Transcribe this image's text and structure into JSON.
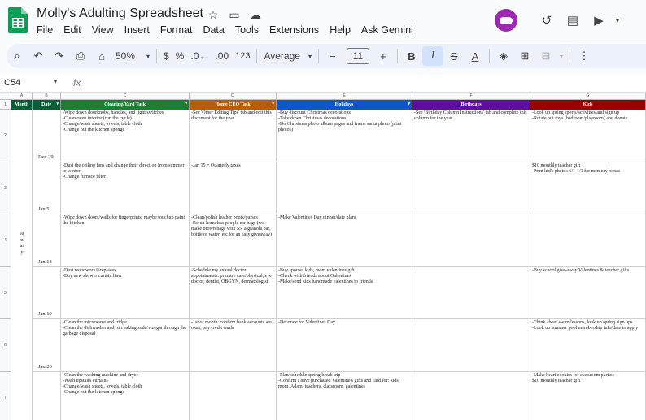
{
  "app": {
    "title": "Molly's Adulting Spreadsheet",
    "menu": [
      "File",
      "Edit",
      "View",
      "Insert",
      "Format",
      "Data",
      "Tools",
      "Extensions",
      "Help",
      "Ask Gemini"
    ]
  },
  "toolbar": {
    "zoom": "50%",
    "currency": "$",
    "percent": "%",
    "dec_decrease": ".0←",
    "dec_increase": ".00",
    "number_format": "123",
    "font": "Average",
    "font_size": "11",
    "bold": "B",
    "italic": "I",
    "strike": "S",
    "text_color": "A"
  },
  "formula_bar": {
    "cell_ref": "C54",
    "fx": "fx"
  },
  "columns": {
    "letters": [
      "A",
      "B",
      "C",
      "D",
      "E",
      "F",
      "G"
    ],
    "headers": [
      {
        "label": "Month",
        "color": "#0b5d3a"
      },
      {
        "label": "Date",
        "color": "#0b5d3a"
      },
      {
        "label": "Cleaning/Yard Task",
        "color": "#1e7e34"
      },
      {
        "label": "Home CEO Task",
        "color": "#b45f06"
      },
      {
        "label": "Holidays",
        "color": "#1155cc"
      },
      {
        "label": "Birthdays",
        "color": "#5b0f9b"
      },
      {
        "label": "Kids",
        "color": "#990000"
      }
    ]
  },
  "month_label": "January",
  "rows": [
    {
      "num": "2",
      "date": "Dec 29",
      "cleaning": "-Wipe down doorknobs, handles, and light switches\n-Clean oven interior (run the cycle)\n-Change/wash sheets, towels, table cloth\n-Change out the kitchen sponge",
      "ceo": "-See 'Other Editing Tips' tab and edit this document for the year",
      "holidays": "-Buy discount Christmas decorations\n-Take down Christmas decorations\n-Do Christmas photo album pages and frame santa photo (print photos)",
      "birthdays": "-See 'Birthday Column Instructions' tab and complete this column for the year",
      "kids": "-Look up spring sports/activities and sign up\n-Rotate out toys (bedroom/playroom) and donate"
    },
    {
      "num": "3",
      "date": "Jan 5",
      "cleaning": "-Dust the ceiling fans and change their direction from summer to winter\n-Change furnace filter",
      "ceo": "-Jan 15 = Quarterly taxes",
      "holidays": "",
      "birthdays": "",
      "kids": "$10 monthly teacher gift\n-Print kid's photos 6/1-1/1 for memory boxes"
    },
    {
      "num": "4",
      "date": "Jan 12",
      "cleaning": "-Wipe down doors/walls for fingerprints, maybe touchup paint the kitchen",
      "ceo": "-Clean/polish leather boots/purses\n-Re-up homeless people car bags (we make brown bags with $5, a granola bar, bottle of water, etc for an easy giveaway)",
      "holidays": "-Make Valentines Day dinner/date plans",
      "birthdays": "",
      "kids": ""
    },
    {
      "num": "5",
      "date": "Jan 19",
      "cleaning": "-Dust woodwork/fireplaces\n-Buy new shower curtain liner",
      "ceo": "-Schedule my annual doctor appointments: primary care/physical, eye doctor, dentist, OBGYN, dermatologist",
      "holidays": "-Buy spouse, kids, mom valentines gift\n-Check with friends about Galentines\n-Make/send kids handmade valentines to friends",
      "birthdays": "",
      "kids": "-Buy school give-away Valentines & teacher gifts"
    },
    {
      "num": "6",
      "date": "Jan 26",
      "cleaning": "-Clean the microwave and fridge\n-Clean the dishwasher and run baking soda/vinegar through the garbage disposal",
      "ceo": "-1st of month: confirm bank accounts are okay, pay credit cards",
      "holidays": "-Decorate for Valentines Day",
      "birthdays": "",
      "kids": "-Think about swim lessons, look up spring sign ups\n-Look up summer pool membership info/date to apply"
    },
    {
      "num": "7",
      "date": "",
      "cleaning": "-Clean the washing machine and dryer\n-Wash upstairs curtains\n-Change/wash sheets, towels, table cloth\n-Change out the kitchen sponge",
      "ceo": "",
      "holidays": "-Plan/schedule spring break trip\n-Confirm I have purchased Valentine's gifts and card for: kids, mom, Adam, teachers, classroom, galentines",
      "birthdays": "",
      "kids": "-Make heart cookies for classroom parties\n$10 monthly teacher gift"
    }
  ]
}
